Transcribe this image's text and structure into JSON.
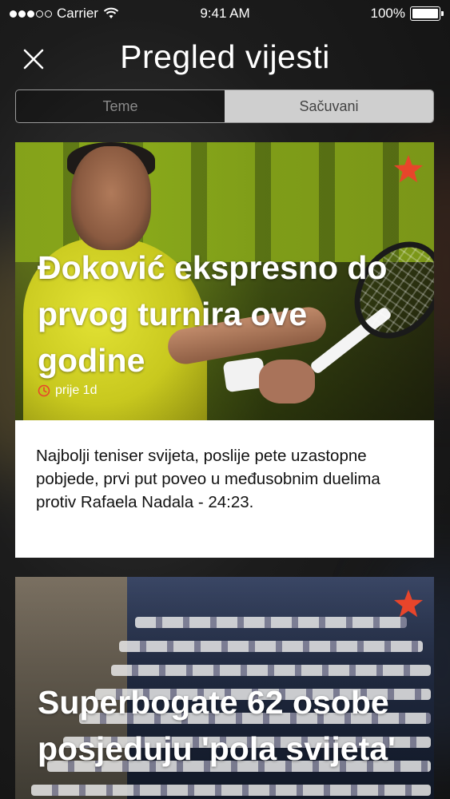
{
  "status_bar": {
    "carrier": "Carrier",
    "time": "9:41 AM",
    "battery": "100%",
    "battery_level": 1.0
  },
  "navbar": {
    "title": "Pregled vijesti",
    "close_icon": "close-icon"
  },
  "segmented": {
    "tabs": [
      {
        "label": "Teme",
        "selected": false
      },
      {
        "label": "Sačuvani",
        "selected": true
      }
    ]
  },
  "articles": [
    {
      "headline": "Đoković ekspresno do prvog turnira ove godine",
      "time": "prije 1d",
      "summary": "Najbolji teniser svijeta, poslije pete uzastopne pobjede, prvi put poveo u međusobnim duelima protiv Rafaela Nadala - 24:23.",
      "saved": true,
      "image": "tennis-player-photo"
    },
    {
      "headline": "Superbogate 62 osobe posjeduju 'pola svijeta'",
      "saved": true,
      "image": "marina-yachts-photo"
    }
  ],
  "colors": {
    "accent": "#e8452b",
    "card_bg": "#ffffff",
    "segment_active": "#cfcfcf"
  }
}
